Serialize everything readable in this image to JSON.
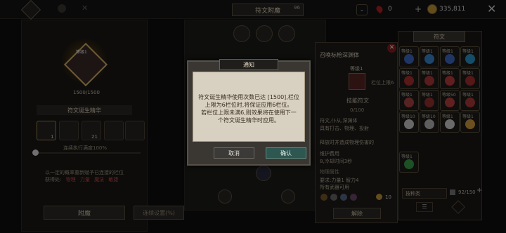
{
  "header": {
    "title": "符文附魔",
    "title_badge": "96",
    "currency_red": "0",
    "currency_gold": "335,811"
  },
  "left": {
    "level_text": "等级1",
    "exp_text": "1500/1500",
    "essence_label": "符文诞生精华",
    "slot_counts": [
      "1",
      "21"
    ],
    "continuous_label": "连续执行满度100%",
    "note_line1": "以一定的概率重新赋予已连接的栏位",
    "note_line2_prefix": "获得处:",
    "note_sources": [
      "物理",
      "力量",
      "魔法",
      "敏捷"
    ],
    "bottom_left_button": "附魔",
    "bottom_right_button": "连续设置(%)"
  },
  "detail": {
    "title": "召唤标枪深渊体",
    "level": "等级1",
    "level_limit": "栏位上限6",
    "section_rune": "技能符文",
    "progress": "0/100",
    "lines": [
      "符文,仆从,深渊体",
      "具有打击、物理、投射",
      "",
      "释放时并造成物理伤害的",
      "",
      "维护费用",
      "8,冷却时间3秒"
    ],
    "attr_title": "物理属性",
    "attr_req": "要求:力量1 智力4",
    "attr_weapon": "所有武器可用",
    "cost_value": "10",
    "remove_button": "解除"
  },
  "right": {
    "title": "符文",
    "runes": [
      {
        "lv": "等级1",
        "color": "#3f6cc8"
      },
      {
        "lv": "等级1",
        "color": "#3a8ad6"
      },
      {
        "lv": "等级1",
        "color": "#3f6cc8"
      },
      {
        "lv": "等级1",
        "color": "#2a9bd1"
      },
      {
        "lv": "等级1",
        "color": "#b03030"
      },
      {
        "lv": "等级1",
        "color": "#b03838"
      },
      {
        "lv": "等级1",
        "color": "#c03c3c"
      },
      {
        "lv": "等级1",
        "color": "#a83030"
      },
      {
        "lv": "等级1",
        "color": "#b34444"
      },
      {
        "lv": "等级1",
        "color": "#9a3030"
      },
      {
        "lv": "等级50",
        "color": "#c04040"
      },
      {
        "lv": "等级1",
        "color": "#b03a3a"
      },
      {
        "lv": "等级10",
        "color": "#cfcfcf"
      },
      {
        "lv": "等级10",
        "color": "#bcbcbc"
      },
      {
        "lv": "等级1",
        "color": "#d4d4d4"
      },
      {
        "lv": "等级1",
        "color": "#d8a040"
      },
      {
        "lv": "等级1",
        "color": "#3aa04a"
      }
    ],
    "filter_label": "按种类",
    "count": "92/150"
  },
  "modal": {
    "title": "通知",
    "message_lines": [
      "符文诞生精华使用次数已达 [1500],栏位",
      "上限为6栏位时,将保证应用6栏位。",
      "若栏位上限未满6,则效果将在使用下一",
      "个符文诞生精华时应用。"
    ],
    "cancel_label": "取消",
    "confirm_label": "确认"
  }
}
